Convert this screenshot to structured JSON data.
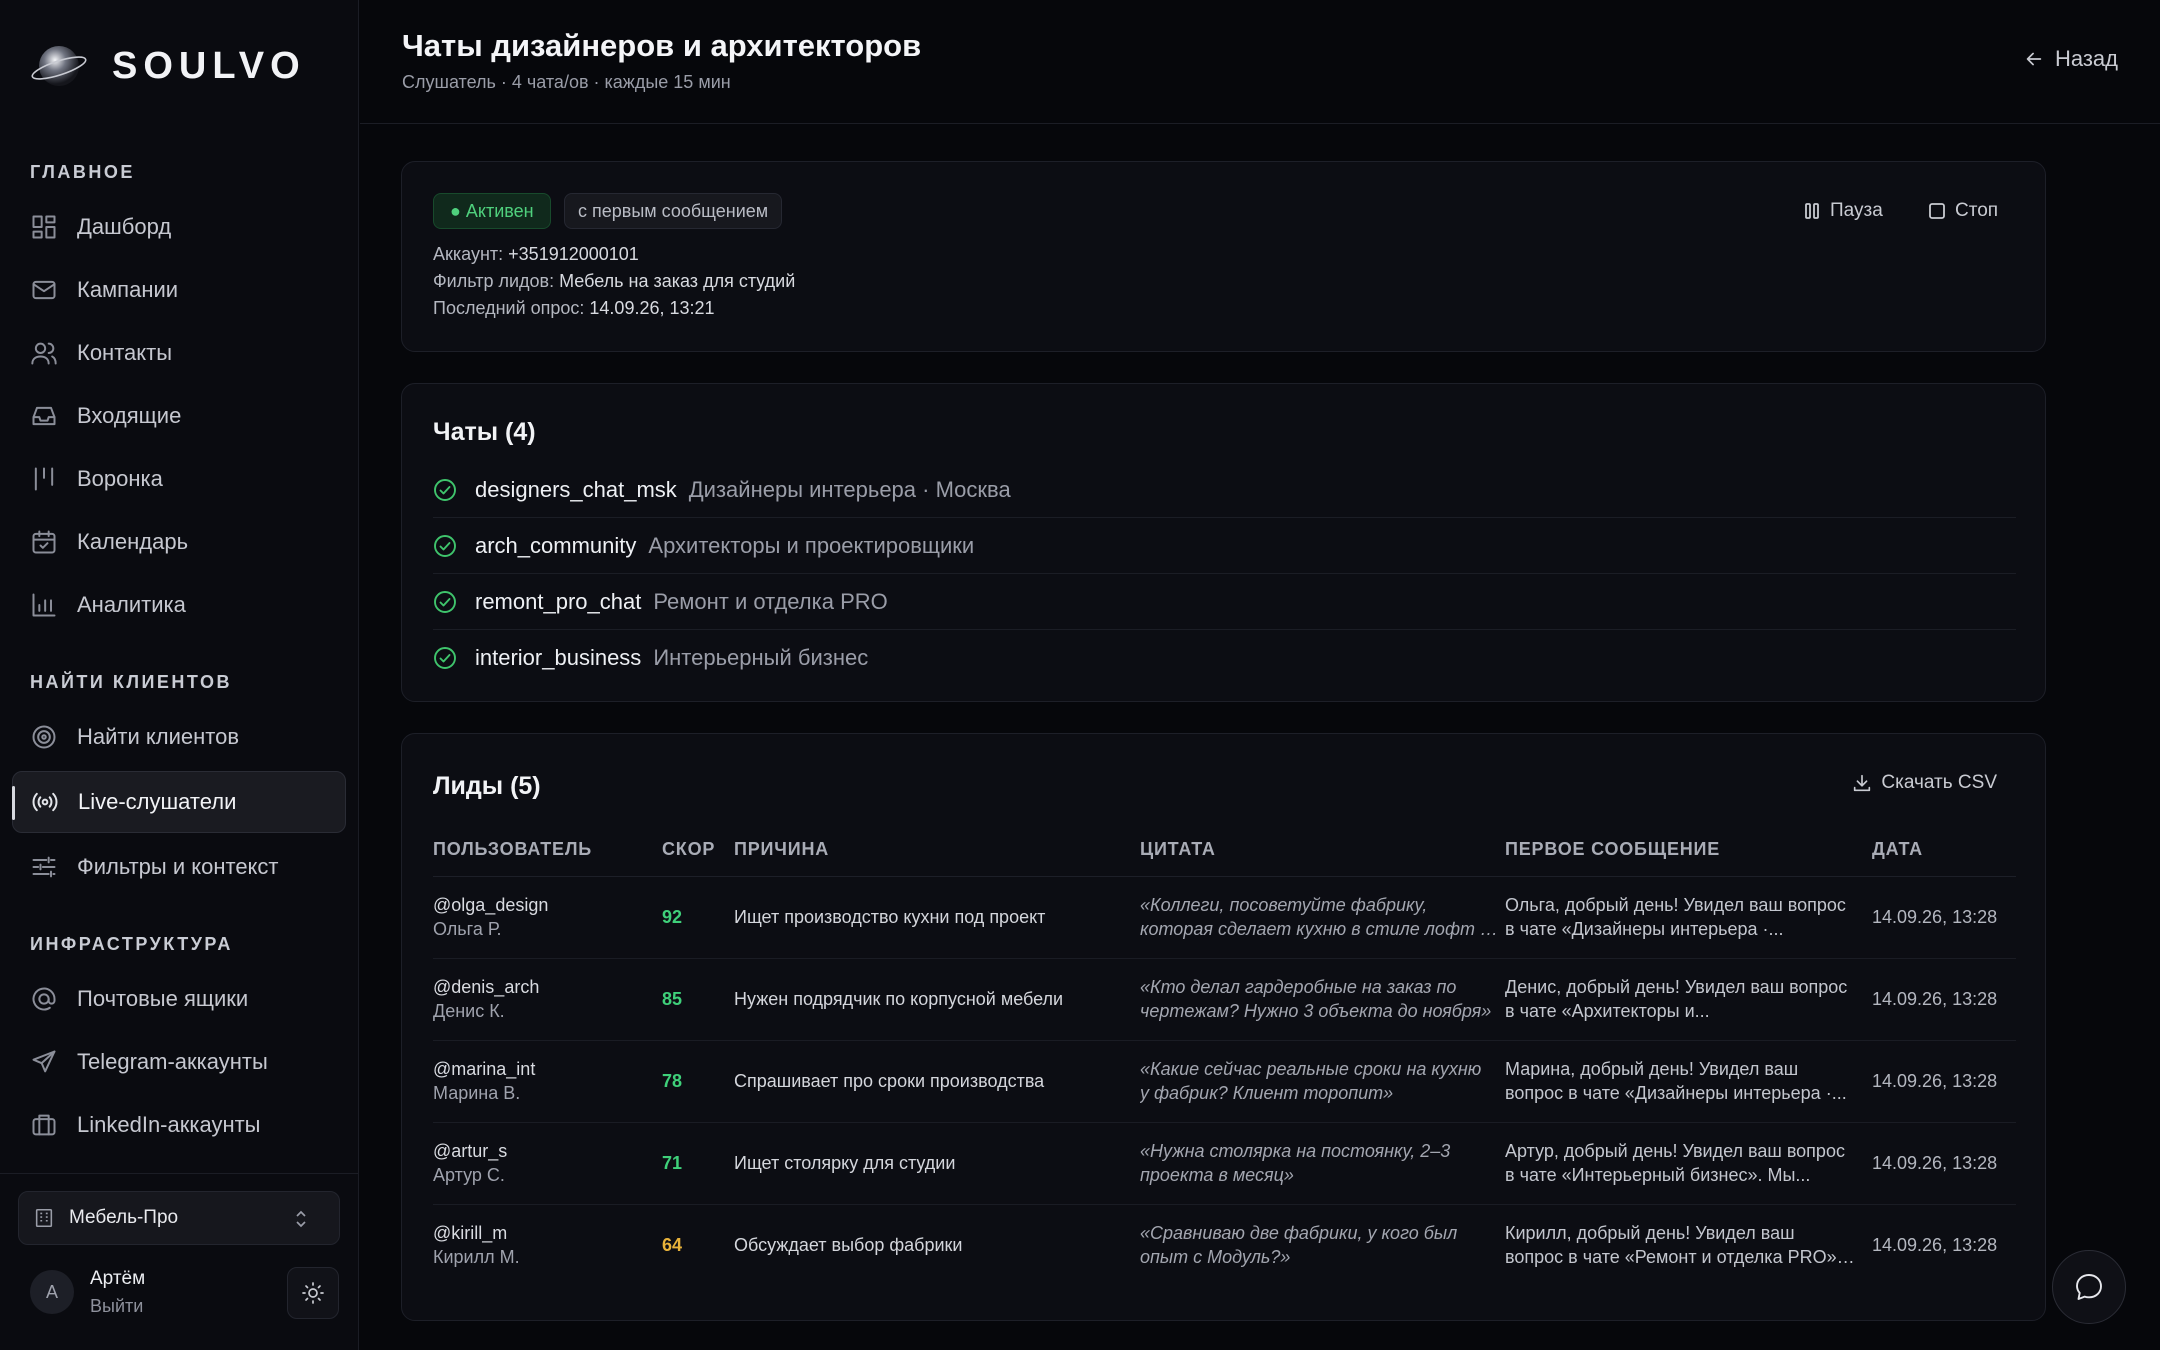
{
  "brand": {
    "name": "SOULVO"
  },
  "sidebar": {
    "sections": [
      {
        "title": "ГЛАВНОЕ"
      },
      {
        "title": "НАЙТИ КЛИЕНТОВ"
      },
      {
        "title": "ИНФРАСТРУКТУРА"
      }
    ],
    "items": [
      {
        "label": "Дашборд",
        "icon": "dashboard-icon"
      },
      {
        "label": "Кампании",
        "icon": "mail-icon"
      },
      {
        "label": "Контакты",
        "icon": "users-icon"
      },
      {
        "label": "Входящие",
        "icon": "inbox-icon"
      },
      {
        "label": "Воронка",
        "icon": "funnel-icon"
      },
      {
        "label": "Календарь",
        "icon": "calendar-icon"
      },
      {
        "label": "Аналитика",
        "icon": "chart-icon"
      },
      {
        "label": "Найти клиентов",
        "icon": "target-icon"
      },
      {
        "label": "Live-слушатели",
        "icon": "broadcast-icon",
        "active": true
      },
      {
        "label": "Фильтры и контекст",
        "icon": "sliders-icon"
      },
      {
        "label": "Почтовые ящики",
        "icon": "at-icon"
      },
      {
        "label": "Telegram-аккаунты",
        "icon": "send-icon"
      },
      {
        "label": "LinkedIn-аккаунты",
        "icon": "briefcase-icon"
      }
    ],
    "workspace": "Мебель-Про",
    "user": {
      "initial": "А",
      "name": "Артём",
      "logout": "Выйти"
    }
  },
  "header": {
    "title": "Чаты дизайнеров и архитекторов",
    "subtitle": "Слушатель · 4 чата/ов · каждые 15 мин",
    "back": "Назад"
  },
  "listener": {
    "status": "● Активен",
    "mode": "с первым сообщением",
    "account_label": "Аккаунт: ",
    "account": "+351912000101",
    "filter_label": "Фильтр лидов: ",
    "filter": "Мебель на заказ для студий",
    "last_poll_label": "Последний опрос: ",
    "last_poll": "14.09.26, 13:21",
    "pause": "Пауза",
    "stop": "Стоп"
  },
  "chats": {
    "title": "Чаты (4)",
    "items": [
      {
        "handle": "designers_chat_msk",
        "desc": "Дизайнеры интерьера · Москва"
      },
      {
        "handle": "arch_community",
        "desc": "Архитекторы и проектировщики"
      },
      {
        "handle": "remont_pro_chat",
        "desc": "Ремонт и отделка PRO"
      },
      {
        "handle": "interior_business",
        "desc": "Интерьерный бизнес"
      }
    ]
  },
  "leads": {
    "title": "Лиды (5)",
    "csv": "Скачать CSV",
    "columns": [
      "ПОЛЬЗОВАТЕЛЬ",
      "СКОР",
      "ПРИЧИНА",
      "ЦИТАТА",
      "ПЕРВОЕ СООБЩЕНИЕ",
      "ДАТА"
    ],
    "rows": [
      {
        "user": "@olga_design",
        "name": "Ольга Р.",
        "score": "92",
        "score_color": "#3fd07a",
        "reason": "Ищет производство кухни под проект",
        "quote1": "«Коллеги, посоветуйте фабрику,",
        "quote2": "которая сделает кухню в стиле лофт з...",
        "first1": "Ольга, добрый день! Увидел ваш вопрос",
        "first2": "в чате «Дизайнеры интерьера ·...",
        "date": "14.09.26, 13:28"
      },
      {
        "user": "@denis_arch",
        "name": "Денис К.",
        "score": "85",
        "score_color": "#3fd07a",
        "reason": "Нужен подрядчик по корпусной мебели",
        "quote1": "«Кто делал гардеробные на заказ по",
        "quote2": "чертежам? Нужно 3 объекта до ноября»",
        "first1": "Денис, добрый день! Увидел ваш вопрос",
        "first2": "в чате «Архитекторы и...",
        "date": "14.09.26, 13:28"
      },
      {
        "user": "@marina_int",
        "name": "Марина В.",
        "score": "78",
        "score_color": "#3fd07a",
        "reason": "Спрашивает про сроки производства",
        "quote1": "«Какие сейчас реальные сроки на кухню",
        "quote2": "у фабрик? Клиент торопит»",
        "first1": "Марина, добрый день! Увидел ваш",
        "first2": "вопрос в чате «Дизайнеры интерьера ·...",
        "date": "14.09.26, 13:28"
      },
      {
        "user": "@artur_s",
        "name": "Артур С.",
        "score": "71",
        "score_color": "#3fd07a",
        "reason": "Ищет столярку для студии",
        "quote1": "«Нужна столярка на постоянку, 2–3",
        "quote2": "проекта в месяц»",
        "first1": "Артур, добрый день! Увидел ваш вопрос",
        "first2": "в чате «Интерьерный бизнес». Мы...",
        "date": "14.09.26, 13:28"
      },
      {
        "user": "@kirill_m",
        "name": "Кирилл М.",
        "score": "64",
        "score_color": "#e8b23a",
        "reason": "Обсуждает выбор фабрики",
        "quote1": "«Сравниваю две фабрики, у кого был",
        "quote2": "опыт с Модуль?»",
        "first1": "Кирилл, добрый день! Увидел ваш",
        "first2": "вопрос в чате «Ремонт и отделка PRO»....",
        "date": "14.09.26, 13:28"
      }
    ]
  },
  "fab": {
    "icon": "chat-bubble-icon"
  }
}
